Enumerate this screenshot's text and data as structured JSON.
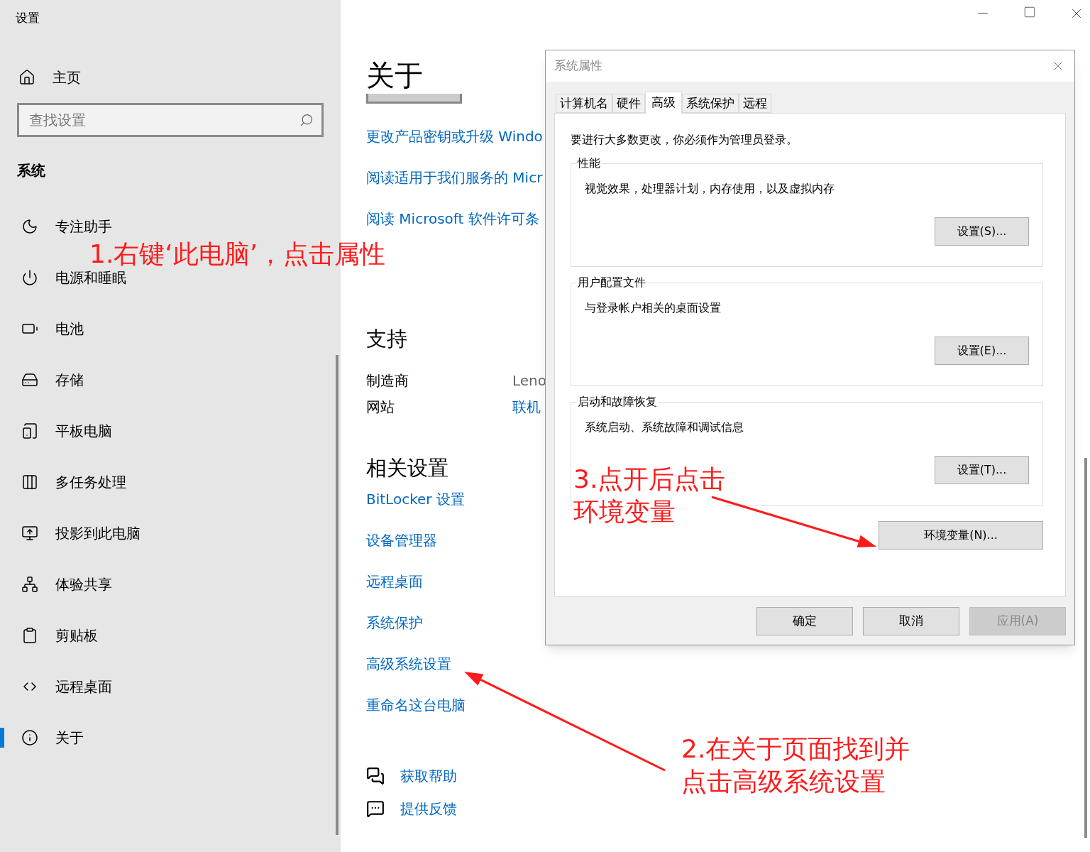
{
  "window": {
    "title": "设置"
  },
  "sidebar": {
    "home": "主页",
    "search": {
      "placeholder": "查找设置"
    },
    "section": "系统",
    "items": [
      {
        "label": "专注助手",
        "selected": false
      },
      {
        "label": "电源和睡眠",
        "selected": false
      },
      {
        "label": "电池",
        "selected": false
      },
      {
        "label": "存储",
        "selected": false
      },
      {
        "label": "平板电脑",
        "selected": false
      },
      {
        "label": "多任务处理",
        "selected": false
      },
      {
        "label": "投影到此电脑",
        "selected": false
      },
      {
        "label": "体验共享",
        "selected": false
      },
      {
        "label": "剪贴板",
        "selected": false
      },
      {
        "label": "远程桌面",
        "selected": false
      },
      {
        "label": "关于",
        "selected": true
      }
    ]
  },
  "main": {
    "heading": "关于",
    "top_links": [
      "更改产品密钥或升级 Windo",
      "阅读适用于我们服务的 Micr",
      "阅读 Microsoft 软件许可条"
    ],
    "support": {
      "heading": "支持",
      "rows": [
        {
          "label": "制造商",
          "value": "Leno",
          "kind": "text"
        },
        {
          "label": "网站",
          "value": "联机",
          "kind": "link"
        }
      ]
    },
    "related": {
      "heading": "相关设置",
      "links": [
        "BitLocker 设置",
        "设备管理器",
        "远程桌面",
        "系统保护",
        "高级系统设置",
        "重命名这台电脑"
      ]
    },
    "help_links": [
      "获取帮助",
      "提供反馈"
    ]
  },
  "dialog": {
    "title": "系统属性",
    "tabs": [
      {
        "label": "计算机名",
        "selected": false
      },
      {
        "label": "硬件",
        "selected": false
      },
      {
        "label": "高级",
        "selected": true
      },
      {
        "label": "系统保护",
        "selected": false
      },
      {
        "label": "远程",
        "selected": false
      }
    ],
    "notice": "要进行大多数更改，你必须作为管理员登录。",
    "groups": [
      {
        "title": "性能",
        "description": "视觉效果，处理器计划，内存使用，以及虚拟内存",
        "button": "设置(S)..."
      },
      {
        "title": "用户配置文件",
        "description": "与登录帐户相关的桌面设置",
        "button": "设置(E)..."
      },
      {
        "title": "启动和故障恢复",
        "description": "系统启动、系统故障和调试信息",
        "button": "设置(T)..."
      }
    ],
    "env_button": "环境变量(N)...",
    "buttons": [
      {
        "label": "确定",
        "disabled": false
      },
      {
        "label": "取消",
        "disabled": false
      },
      {
        "label": "应用(A)",
        "disabled": true
      }
    ]
  },
  "annotations": [
    {
      "lines": [
        "1.右键‘此电脑’，点击属性"
      ]
    },
    {
      "lines": [
        "3.点开后点击",
        "环境变量"
      ]
    },
    {
      "lines": [
        "2.在关于页面找到并",
        "点击高级系统设置"
      ]
    }
  ]
}
